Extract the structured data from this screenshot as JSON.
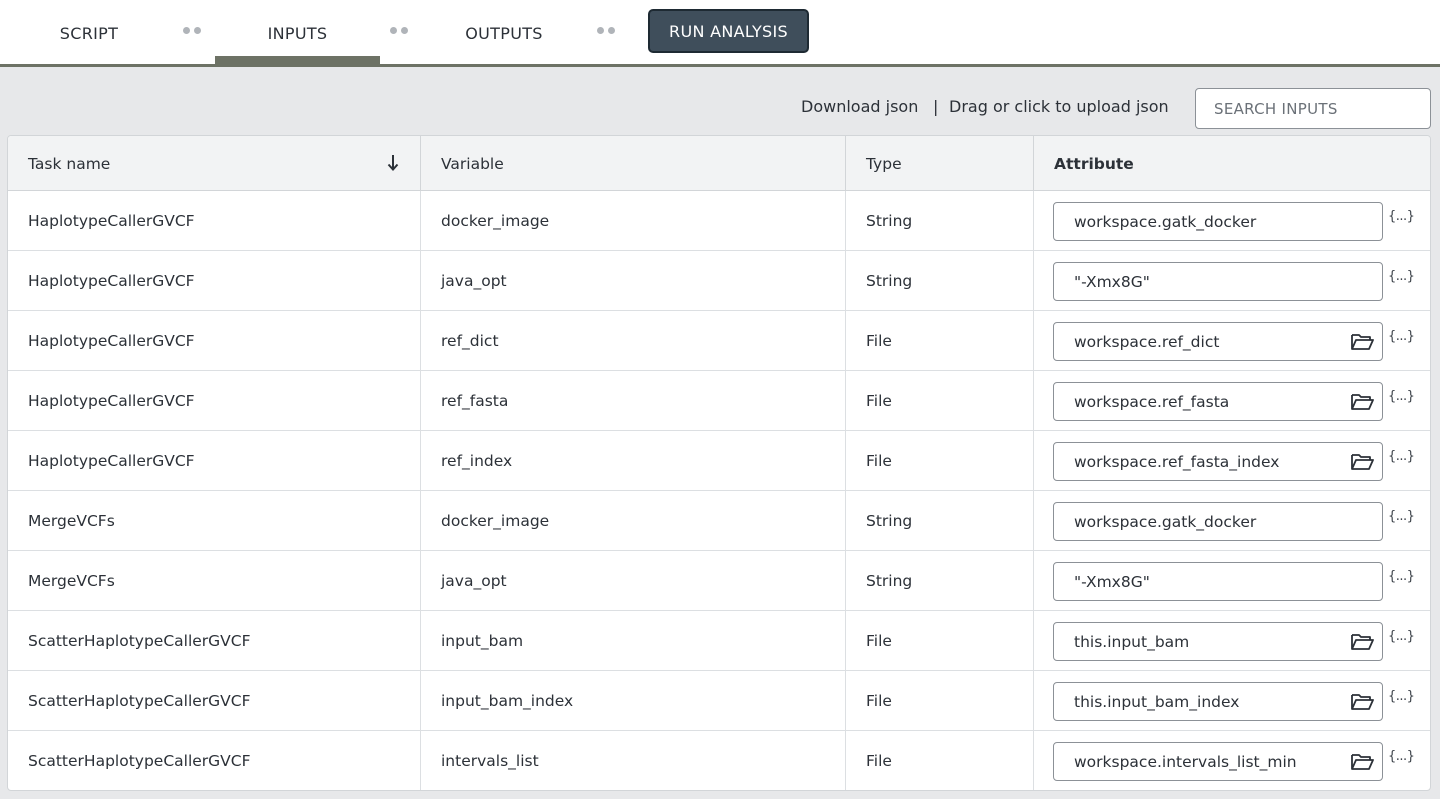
{
  "tabs": {
    "script": "SCRIPT",
    "inputs": "INPUTS",
    "outputs": "OUTPUTS",
    "run": "RUN ANALYSIS"
  },
  "toolbar": {
    "download": "Download json",
    "separator": "|",
    "upload": "Drag or click to upload json",
    "search_placeholder": "SEARCH INPUTS"
  },
  "columns": {
    "task": "Task name",
    "variable": "Variable",
    "type": "Type",
    "attribute": "Attribute"
  },
  "json_icon_label": "{...}",
  "rows": [
    {
      "task": "HaplotypeCallerGVCF",
      "variable": "docker_image",
      "type": "String",
      "attribute": "workspace.gatk_docker"
    },
    {
      "task": "HaplotypeCallerGVCF",
      "variable": "java_opt",
      "type": "String",
      "attribute": "\"-Xmx8G\""
    },
    {
      "task": "HaplotypeCallerGVCF",
      "variable": "ref_dict",
      "type": "File",
      "attribute": "workspace.ref_dict"
    },
    {
      "task": "HaplotypeCallerGVCF",
      "variable": "ref_fasta",
      "type": "File",
      "attribute": "workspace.ref_fasta"
    },
    {
      "task": "HaplotypeCallerGVCF",
      "variable": "ref_index",
      "type": "File",
      "attribute": "workspace.ref_fasta_index"
    },
    {
      "task": "MergeVCFs",
      "variable": "docker_image",
      "type": "String",
      "attribute": "workspace.gatk_docker"
    },
    {
      "task": "MergeVCFs",
      "variable": "java_opt",
      "type": "String",
      "attribute": "\"-Xmx8G\""
    },
    {
      "task": "ScatterHaplotypeCallerGVCF",
      "variable": "input_bam",
      "type": "File",
      "attribute": "this.input_bam"
    },
    {
      "task": "ScatterHaplotypeCallerGVCF",
      "variable": "input_bam_index",
      "type": "File",
      "attribute": "this.input_bam_index"
    },
    {
      "task": "ScatterHaplotypeCallerGVCF",
      "variable": "intervals_list",
      "type": "File",
      "attribute": "workspace.intervals_list_min"
    }
  ]
}
